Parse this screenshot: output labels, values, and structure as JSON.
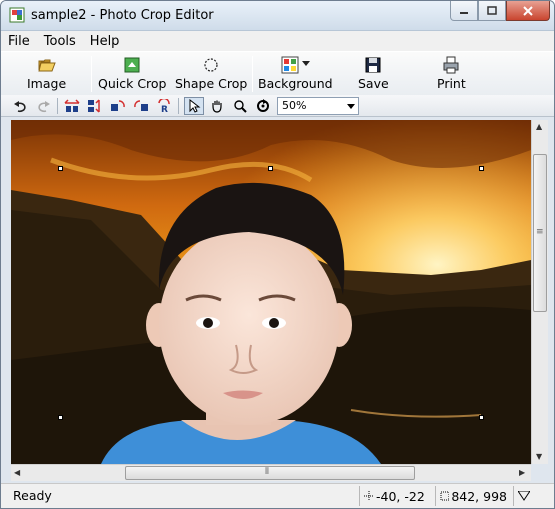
{
  "window": {
    "title": "sample2 - Photo Crop Editor"
  },
  "menu": {
    "items": [
      "File",
      "Tools",
      "Help"
    ]
  },
  "toolbar": {
    "image_label": "Image",
    "quick_crop_label": "Quick Crop",
    "shape_crop_label": "Shape Crop",
    "background_label": "Background",
    "save_label": "Save",
    "print_label": "Print"
  },
  "toolbar2": {
    "zoom_value": "50%"
  },
  "status": {
    "text": "Ready",
    "position": "-40, -22",
    "size": "842, 998"
  },
  "colors": {
    "accent": "#3a6ea5",
    "close": "#c9452f"
  }
}
